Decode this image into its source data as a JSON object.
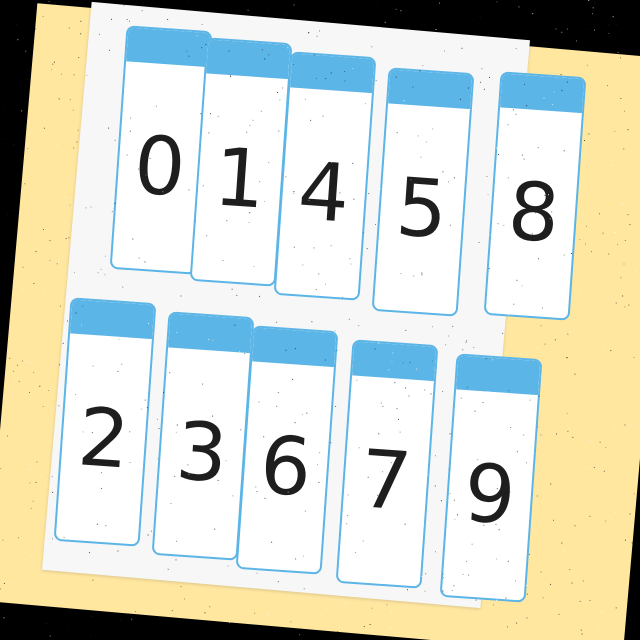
{
  "colors": {
    "background": "#000000",
    "mat": "#ffe7a0",
    "sheet": "#f7f7f7",
    "card_border": "#5bb5e6",
    "card_band": "#5bb5e6",
    "card_face": "#ffffff",
    "digit": "#1e1e1e"
  },
  "cards": [
    {
      "digit": "0"
    },
    {
      "digit": "1"
    },
    {
      "digit": "4"
    },
    {
      "digit": "5"
    },
    {
      "digit": "8"
    },
    {
      "digit": "2"
    },
    {
      "digit": "3"
    },
    {
      "digit": "6"
    },
    {
      "digit": "7"
    },
    {
      "digit": "9"
    }
  ]
}
